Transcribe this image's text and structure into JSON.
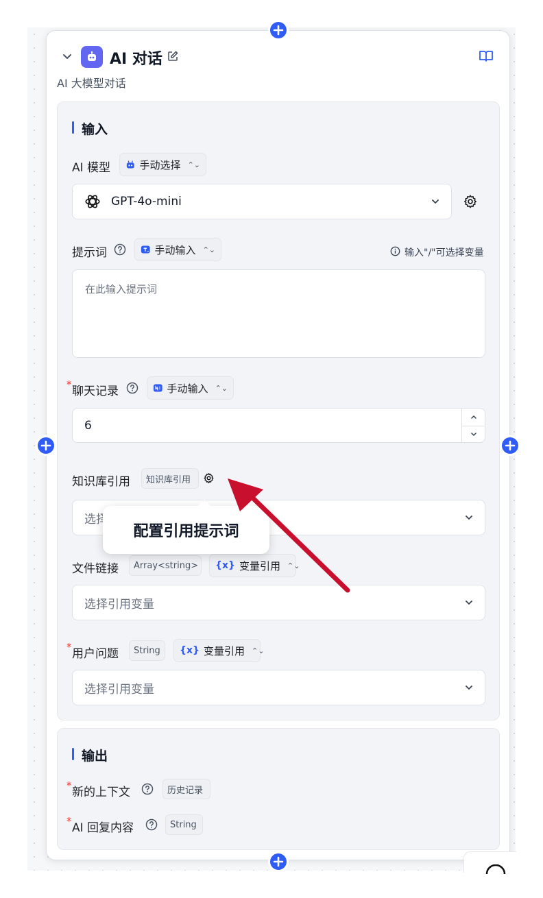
{
  "node": {
    "title": "AI 对话",
    "description": "AI 大模型对话"
  },
  "input_section": {
    "title": "输入",
    "ai_model": {
      "label": "AI 模型",
      "mode": "手动选择",
      "selected_model": "GPT-4o-mini"
    },
    "prompt": {
      "label": "提示词",
      "mode": "手动输入",
      "hint": "输入\"/\"可选择变量",
      "placeholder": "在此输入提示词"
    },
    "chat_history": {
      "label": "聊天记录",
      "mode": "手动输入",
      "value": "6"
    },
    "knowledge": {
      "label": "知识库引用",
      "tag": "知识库引用",
      "placeholder": "选择"
    },
    "tooltip": "配置引用提示词",
    "file_link": {
      "label": "文件链接",
      "type_tag": "Array<string>",
      "mode": "变量引用",
      "placeholder": "选择引用变量"
    },
    "user_question": {
      "label": "用户问题",
      "type_tag": "String",
      "mode": "变量引用",
      "placeholder": "选择引用变量"
    }
  },
  "output_section": {
    "title": "输出",
    "items": [
      {
        "label": "新的上下文",
        "tag": "历史记录"
      },
      {
        "label": "AI 回复内容",
        "tag": "String"
      }
    ]
  },
  "required_mark": "*",
  "var_symbol": "{x}",
  "colors": {
    "accent": "#2f5cf5",
    "node_icon": "#6366f1",
    "required": "#e53935",
    "arrow": "#c8102e"
  }
}
